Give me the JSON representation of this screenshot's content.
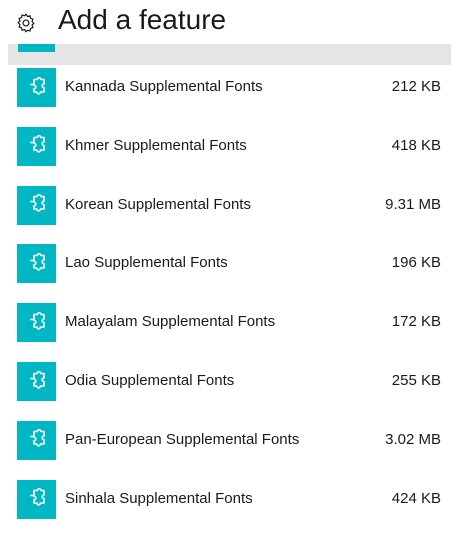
{
  "header": {
    "title": "Add a feature",
    "gear_icon": "gear-icon"
  },
  "colors": {
    "accent": "#00b7c3",
    "highlight": "#e5e5e5"
  },
  "features": [
    {
      "name": "Kannada Supplemental Fonts",
      "size": "212 KB",
      "icon": "puzzle-icon"
    },
    {
      "name": "Khmer Supplemental Fonts",
      "size": "418 KB",
      "icon": "puzzle-icon"
    },
    {
      "name": "Korean Supplemental Fonts",
      "size": "9.31 MB",
      "icon": "puzzle-icon"
    },
    {
      "name": "Lao Supplemental Fonts",
      "size": "196 KB",
      "icon": "puzzle-icon"
    },
    {
      "name": "Malayalam Supplemental Fonts",
      "size": "172 KB",
      "icon": "puzzle-icon"
    },
    {
      "name": "Odia Supplemental Fonts",
      "size": "255 KB",
      "icon": "puzzle-icon"
    },
    {
      "name": "Pan-European Supplemental Fonts",
      "size": "3.02 MB",
      "icon": "puzzle-icon"
    },
    {
      "name": "Sinhala Supplemental Fonts",
      "size": "424 KB",
      "icon": "puzzle-icon"
    }
  ]
}
